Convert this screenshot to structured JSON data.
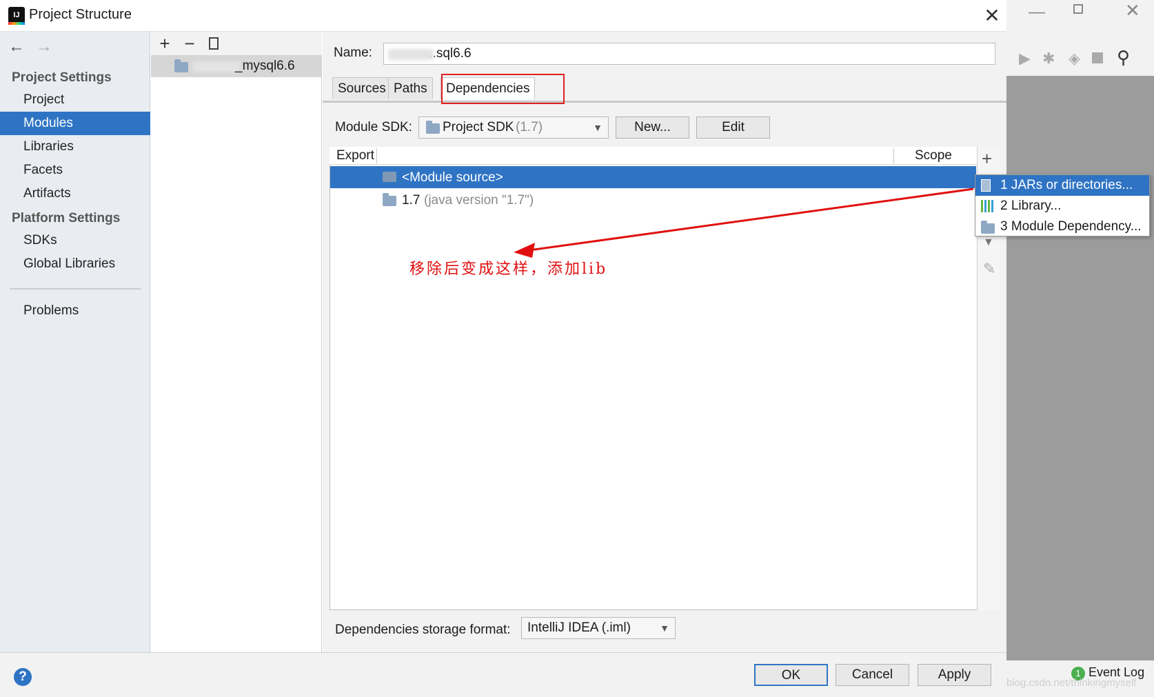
{
  "window": {
    "title": "Project Structure"
  },
  "sidebar": {
    "project_settings_header": "Project Settings",
    "platform_settings_header": "Platform Settings",
    "items": [
      {
        "label": "Project"
      },
      {
        "label": "Modules"
      },
      {
        "label": "Libraries"
      },
      {
        "label": "Facets"
      },
      {
        "label": "Artifacts"
      },
      {
        "label": "SDKs"
      },
      {
        "label": "Global Libraries"
      },
      {
        "label": "Problems"
      }
    ]
  },
  "modules": {
    "toolbar": {
      "add": "+",
      "remove": "−"
    },
    "module_name": "_mysql6.6"
  },
  "details": {
    "name_label": "Name:",
    "name_value": "...sql6.6",
    "tabs": [
      "Sources",
      "Paths",
      "Dependencies"
    ],
    "module_sdk_label": "Module SDK:",
    "sdk_value": "Project SDK",
    "sdk_version": "(1.7)",
    "new_button": "New...",
    "edit_button": "Edit",
    "columns": {
      "export": "Export",
      "scope": "Scope"
    },
    "rows": [
      {
        "text": "<Module source>"
      },
      {
        "text": "1.7",
        "detail": "(java version \"1.7\")"
      }
    ],
    "storage_label": "Dependencies storage format:",
    "storage_value": "IntelliJ IDEA (.iml)"
  },
  "add_popup": {
    "items": [
      "1  JARs or directories...",
      "2  Library...",
      "3  Module Dependency..."
    ]
  },
  "annotation": "移除后变成这样，添加lib",
  "footer": {
    "ok": "OK",
    "cancel": "Cancel",
    "apply": "Apply",
    "help": "?"
  },
  "ide": {
    "event_log": "Event Log",
    "event_count": "1",
    "watermark": "https://blog.csdn.net/thinkingmyself"
  },
  "colors": {
    "selection": "#2f74c4",
    "annotation": "#e01010"
  }
}
